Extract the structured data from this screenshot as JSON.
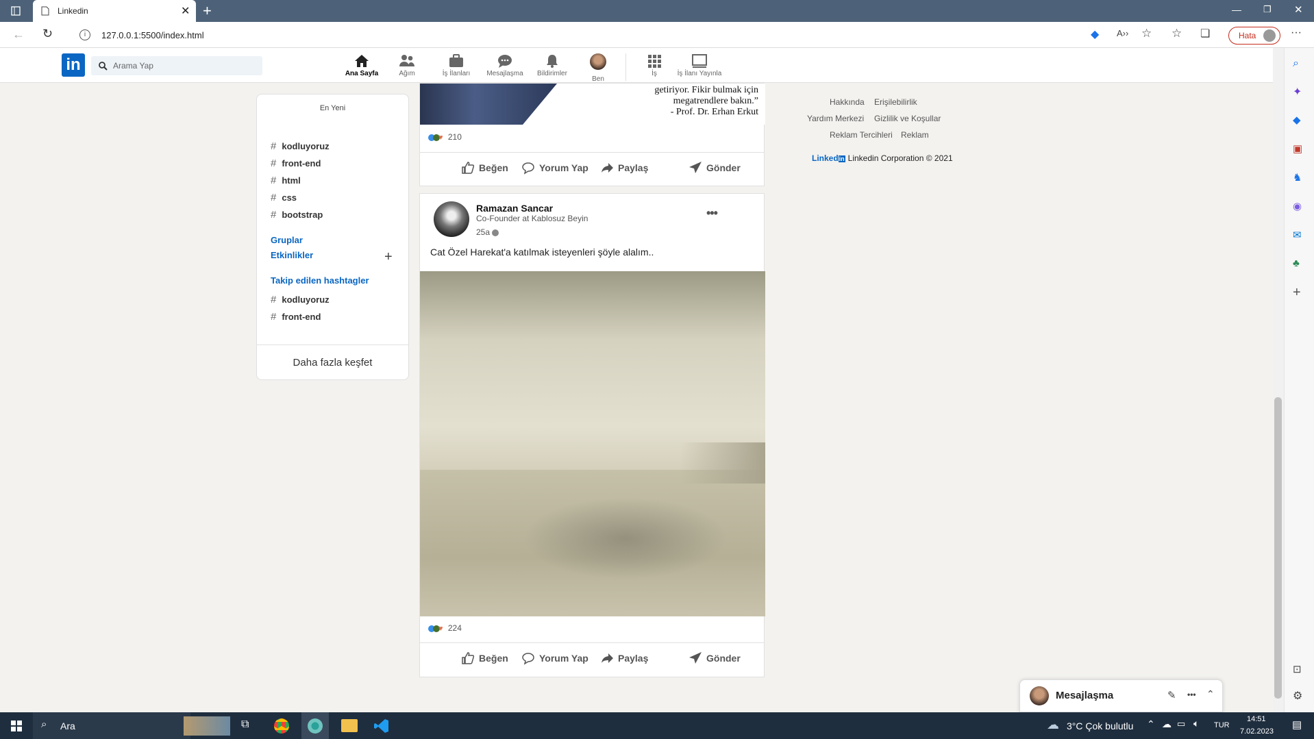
{
  "browser": {
    "tab_title": "Linkedin",
    "url": "127.0.0.1:5500/index.html",
    "error_label": "Hata"
  },
  "nav": {
    "logo": "in",
    "search_placeholder": "Arama Yap",
    "items": [
      {
        "label": "Ana Sayfa",
        "icon": "home-icon"
      },
      {
        "label": "Ağım",
        "icon": "network-icon"
      },
      {
        "label": "İş İlanları",
        "icon": "briefcase-icon"
      },
      {
        "label": "Mesajlaşma",
        "icon": "chat-icon"
      },
      {
        "label": "Bildirimler",
        "icon": "bell-icon"
      },
      {
        "label": "Ben",
        "icon": "avatar"
      },
      {
        "label": "İş",
        "icon": "grid-icon"
      },
      {
        "label": "İş İlanı Yayınla",
        "icon": "post-job-icon"
      }
    ]
  },
  "left": {
    "recent_title": "En Yeni",
    "hashtags": [
      "kodluyoruz",
      "front-end",
      "html",
      "css",
      "bootstrap"
    ],
    "groups": "Gruplar",
    "events": "Etkinlikler",
    "followed_title": "Takip edilen hashtagler",
    "followed": [
      "kodluyoruz",
      "front-end"
    ],
    "more": "Daha fazla keşfet"
  },
  "post1": {
    "quote_line1": "getiriyor. Fikir bulmak için",
    "quote_line2": "megatrendlere bakın.”",
    "quote_line3": "- Prof. Dr. Erhan Erkut",
    "reactions": "210"
  },
  "post2": {
    "author": "Ramazan Sancar",
    "headline": "Co-Founder at Kablosuz Beyin",
    "time": "25a",
    "text": "Cat Özel Harekat'a katılmak isteyenleri şöyle alalım..",
    "reactions": "224"
  },
  "actions": {
    "like": "Beğen",
    "comment": "Yorum Yap",
    "share": "Paylaş",
    "send": "Gönder"
  },
  "footer": {
    "links": [
      "Hakkında",
      "Erişilebilirlik",
      "Yardım Merkezi",
      "Gizlilik ve Koşullar",
      "Reklam Tercihleri",
      "Reklam"
    ],
    "brand": "Linked",
    "copyright": "Linkedin Corporation © 2021"
  },
  "messaging": {
    "title": "Mesajlaşma"
  },
  "taskbar": {
    "search": "Ara",
    "weather": "3°C  Çok bulutlu",
    "lang": "TUR",
    "time": "14:51",
    "date": "7.02.2023"
  },
  "colors": {
    "brand": "#0a66c2",
    "taskbar": "#1f2e3f",
    "titlebar": "#4d6278"
  }
}
